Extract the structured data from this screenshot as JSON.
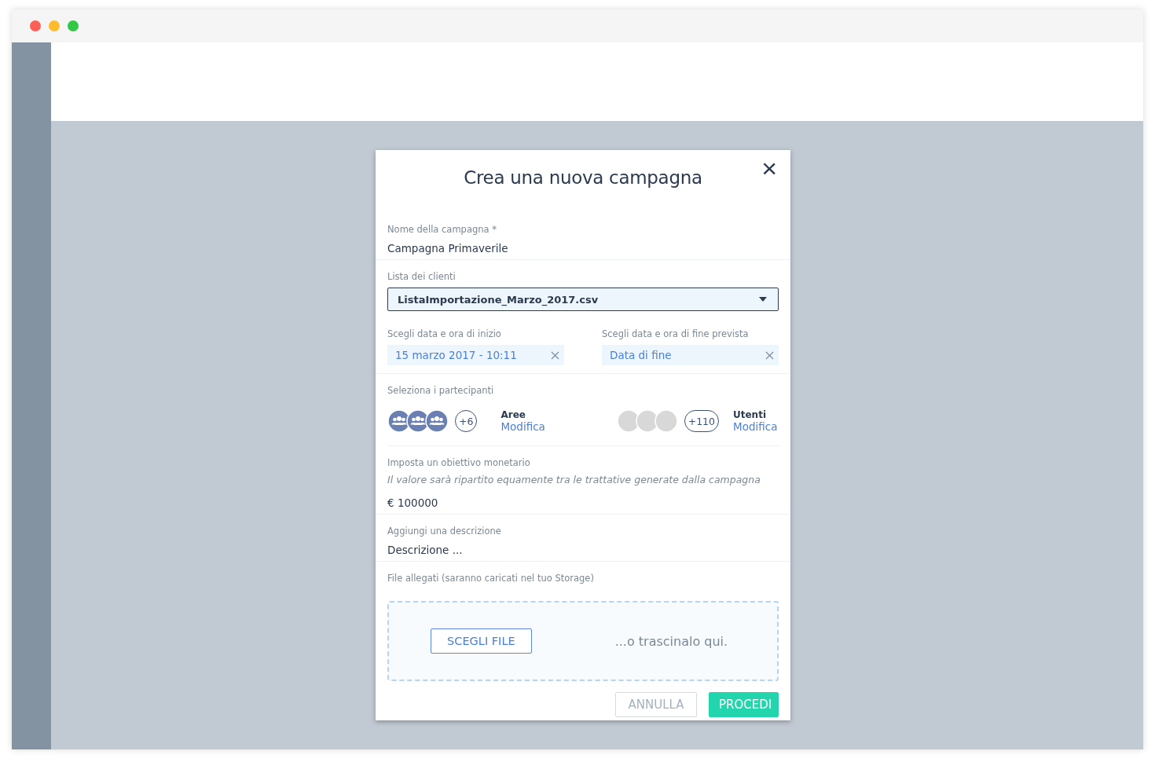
{
  "dialog": {
    "title": "Crea una nuova campagna",
    "close": "×"
  },
  "name_field": {
    "label": "Nome della campagna *",
    "value": "Campagna Primaverile"
  },
  "client_list": {
    "label": "Lista dei clienti",
    "value": "ListaImportazione_Marzo_2017.csv"
  },
  "dates": [
    {
      "label": "Scegli data e ora di inizio",
      "value": "15 marzo 2017 - 10:11"
    },
    {
      "label": "Scegli data e ora di fine prevista",
      "placeholder": "Data di fine"
    }
  ],
  "participants": {
    "label": "Seleziona i partecipanti",
    "groups": [
      {
        "kind": "group",
        "count": "+6",
        "title": "Aree",
        "link": "Modifica"
      },
      {
        "kind": "user",
        "count": "+110",
        "title": "Utenti",
        "link": "Modifica"
      }
    ]
  },
  "goal": {
    "label": "Imposta un obiettivo monetario",
    "hint": "Il valore sarà ripartito equamente tra le trattative generate dalla campagna",
    "value": "€ 100000"
  },
  "description": {
    "label": "Aggiungi una descrizione",
    "placeholder": "Descrizione ..."
  },
  "attachments": {
    "label": "File allegati (saranno caricati nel tuo Storage)",
    "button": "SCEGLI FILE",
    "drop_text": "...o trascinalo qui."
  },
  "actions": [
    {
      "kind": "secondary",
      "label": "ANNULLA",
      "disabled": true
    },
    {
      "kind": "primary",
      "label": "PROCEDI",
      "disabled": false
    }
  ]
}
